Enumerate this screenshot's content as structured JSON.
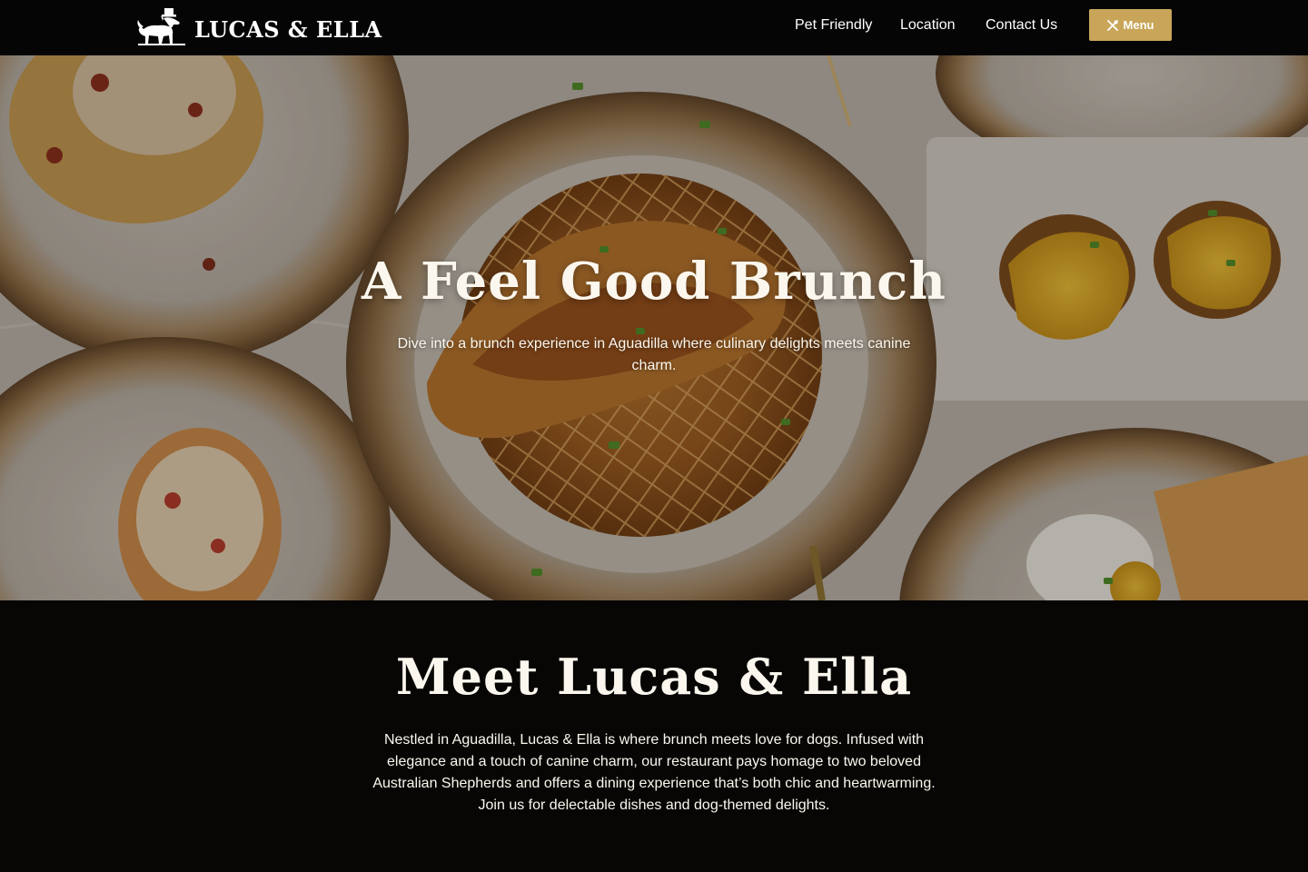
{
  "brand": {
    "name": "LUCAS & ELLA",
    "logo_icon": "dog-silhouette-logo"
  },
  "nav": {
    "items": [
      {
        "label": "Pet Friendly"
      },
      {
        "label": "Location"
      },
      {
        "label": "Contact Us"
      }
    ],
    "menu_button": {
      "label": "Menu",
      "icon": "utensils-icon"
    }
  },
  "hero": {
    "title": "A Feel Good Brunch",
    "subtitle": "Dive into a brunch experience in Aguadilla where culinary delights meets canine charm."
  },
  "meet": {
    "title": "Meet Lucas & Ella",
    "text": "Nestled in Aguadilla, Lucas & Ella is where brunch meets love for dogs. Infused with elegance and a touch of canine charm, our restaurant pays homage to two beloved Australian Shepherds and offers a dining experience that’s both chic and heartwarming. Join us for delectable dishes and dog-themed delights."
  },
  "colors": {
    "accent": "#c9a559",
    "header_bg": "#050505",
    "section_bg": "#080604",
    "text": "#fbf7ee"
  }
}
